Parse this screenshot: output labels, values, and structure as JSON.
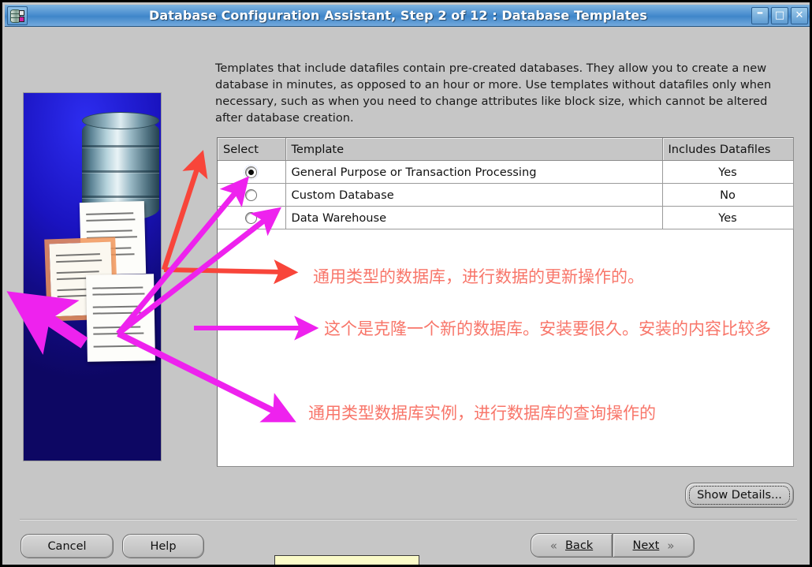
{
  "window": {
    "title": "Database Configuration Assistant, Step 2 of 12 : Database Templates",
    "icon": "database-app-icon",
    "controls": {
      "minimize": "–",
      "maximize": "□",
      "close": "✕"
    }
  },
  "main": {
    "description": "Templates that include datafiles contain pre-created databases. They allow you to create a new database in minutes, as opposed to an hour or more. Use templates without datafiles only when necessary, such as when you need to change attributes like block size, which cannot be altered after database creation."
  },
  "table": {
    "headers": [
      "Select",
      "Template",
      "Includes Datafiles"
    ],
    "rows": [
      {
        "selected": true,
        "template": "General Purpose or Transaction Processing",
        "datafiles": "Yes"
      },
      {
        "selected": false,
        "template": "Custom Database",
        "datafiles": "No"
      },
      {
        "selected": false,
        "template": "Data Warehouse",
        "datafiles": "Yes"
      }
    ]
  },
  "annotations": [
    "通用类型的数据库，进行数据的更新操作的。",
    "这个是克隆一个新的数据库。安装要很久。安装的内容比较多",
    "通用类型数据库实例，进行数据库的查询操作的"
  ],
  "buttons": {
    "cancel": "Cancel",
    "help": "Help",
    "show_details": "Show Details...",
    "back": "Back",
    "next": "Next",
    "back_chevron": "«",
    "next_chevron": "»"
  },
  "colors": {
    "title_bar": "#4b8fd0",
    "selection": "#0000ee",
    "annotation_text": "#f8766a",
    "arrow_red": "#f8453a",
    "arrow_magenta": "#ee22ee",
    "panel_face": "#c6c6c6",
    "art_blue": "#1a13c0"
  }
}
